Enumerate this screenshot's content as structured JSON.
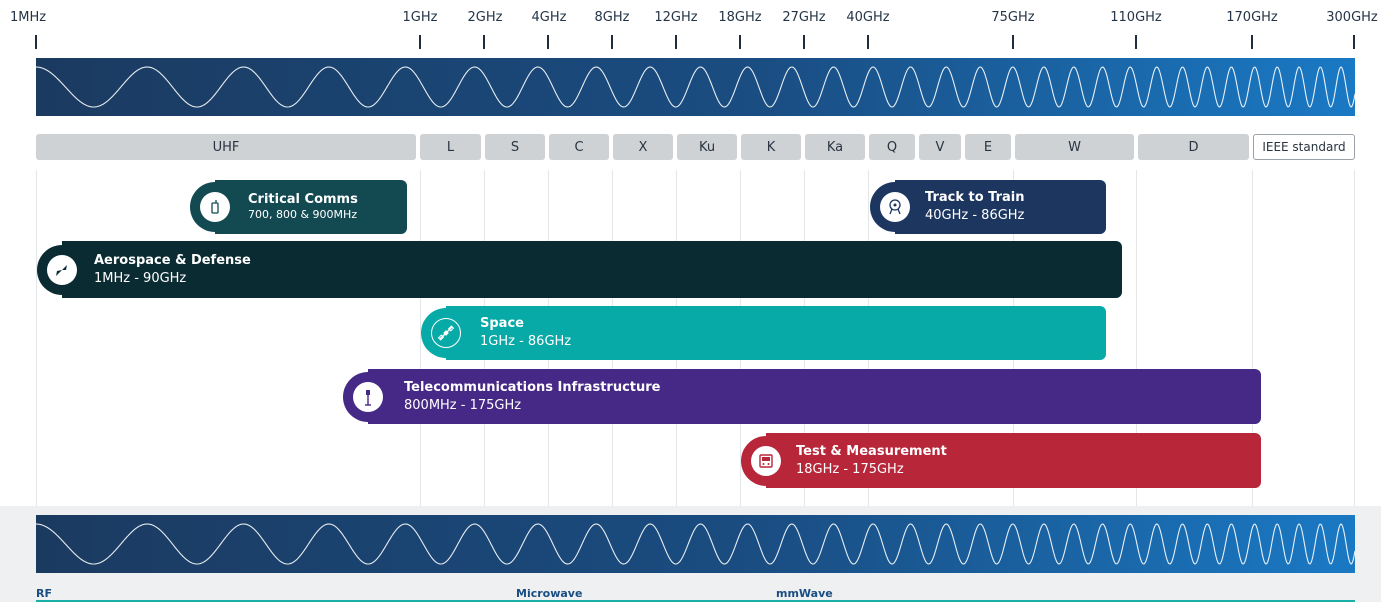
{
  "frequencies": [
    "1MHz",
    "1GHz",
    "2GHz",
    "4GHz",
    "8GHz",
    "12GHz",
    "18GHz",
    "27GHz",
    "40GHz",
    "75GHz",
    "110GHz",
    "170GHz",
    "300GHz"
  ],
  "bands": [
    "UHF",
    "L",
    "S",
    "C",
    "X",
    "Ku",
    "K",
    "Ka",
    "Q",
    "V",
    "E",
    "W",
    "D"
  ],
  "standard_label": "IEEE standard",
  "applications": [
    {
      "title": "Critical Comms",
      "range": "700, 800 & 900MHz",
      "icon": "radio-icon",
      "color": "#134a52"
    },
    {
      "title": "Track to Train",
      "range": "40GHz - 86GHz",
      "icon": "train-icon",
      "color": "#1c3660"
    },
    {
      "title": "Aerospace & Defense",
      "range": "1MHz - 90GHz",
      "icon": "jet-icon",
      "color": "#0b2b33"
    },
    {
      "title": "Space",
      "range": "1GHz - 86GHz",
      "icon": "satellite-icon",
      "color": "#08aaa8"
    },
    {
      "title": "Telecommunications Infrastructure",
      "range": "800MHz - 175GHz",
      "icon": "antenna-icon",
      "color": "#462886"
    },
    {
      "title": "Test & Measurement",
      "range": "18GHz - 175GHz",
      "icon": "instrument-icon",
      "color": "#b8263a"
    }
  ],
  "regions": [
    "RF",
    "Microwave",
    "mmWave"
  ]
}
